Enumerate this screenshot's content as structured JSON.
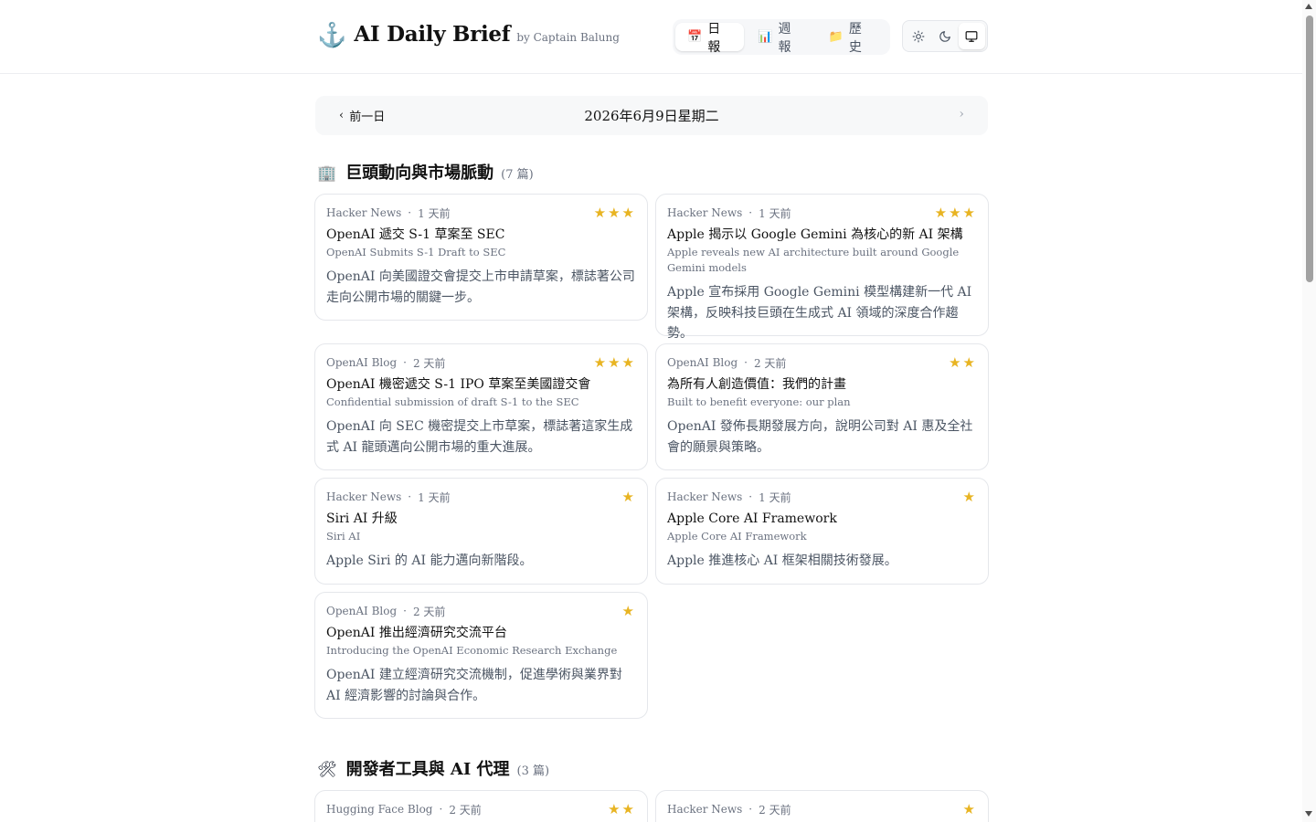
{
  "header": {
    "anchor_glyph": "⚓",
    "title": "AI Daily Brief",
    "byline": "by Captain Balung",
    "tabs": [
      {
        "label": "日報",
        "icon": "calendar-icon",
        "glyph": "📅"
      },
      {
        "label": "週報",
        "icon": "bar-chart-icon",
        "glyph": "📊"
      },
      {
        "label": "歷史",
        "icon": "folder-icon",
        "glyph": "📁"
      }
    ],
    "theme": {
      "active": "system"
    }
  },
  "datenav": {
    "prev_label": "前一日",
    "date": "2026年6月9日星期二"
  },
  "sections": [
    {
      "icon": "building-icon",
      "glyph": "🏢",
      "title": "巨頭動向與市場脈動",
      "count": "(7 篇)",
      "cards": [
        {
          "source": "Hacker News",
          "time": "1 天前",
          "stars": 3,
          "title": "OpenAI 遞交 S-1 草案至 SEC",
          "subtitle": "OpenAI Submits S-1 Draft to SEC",
          "desc": "OpenAI 向美國證交會提交上市申請草案，標誌著公司走向公開市場的關鍵一步。"
        },
        {
          "source": "Hacker News",
          "time": "1 天前",
          "stars": 3,
          "title": "Apple 揭示以 Google Gemini 為核心的新 AI 架構",
          "subtitle": "Apple reveals new AI architecture built around Google Gemini models",
          "desc": "Apple 宣布採用 Google Gemini 模型構建新一代 AI 架構，反映科技巨頭在生成式 AI 領域的深度合作趨勢。"
        },
        {
          "source": "OpenAI Blog",
          "time": "2 天前",
          "stars": 3,
          "title": "OpenAI 機密遞交 S-1 IPO 草案至美國證交會",
          "subtitle": "Confidential submission of draft S-1 to the SEC",
          "desc": "OpenAI 向 SEC 機密提交上市草案，標誌著這家生成式 AI 龍頭邁向公開市場的重大進展。"
        },
        {
          "source": "OpenAI Blog",
          "time": "2 天前",
          "stars": 2,
          "title": "為所有人創造價值：我們的計畫",
          "subtitle": "Built to benefit everyone: our plan",
          "desc": "OpenAI 發佈長期發展方向，說明公司對 AI 惠及全社會的願景與策略。"
        },
        {
          "source": "Hacker News",
          "time": "1 天前",
          "stars": 1,
          "title": "Siri AI 升級",
          "subtitle": "Siri AI",
          "desc": "Apple Siri 的 AI 能力邁向新階段。"
        },
        {
          "source": "Hacker News",
          "time": "1 天前",
          "stars": 1,
          "title": "Apple Core AI Framework",
          "subtitle": "Apple Core AI Framework",
          "desc": "Apple 推進核心 AI 框架相關技術發展。"
        },
        {
          "source": "OpenAI Blog",
          "time": "2 天前",
          "stars": 1,
          "title": "OpenAI 推出經濟研究交流平台",
          "subtitle": "Introducing the OpenAI Economic Research Exchange",
          "desc": "OpenAI 建立經濟研究交流機制，促進學術與業界對 AI 經濟影響的討論與合作。"
        }
      ]
    },
    {
      "icon": "hammer-wrench-icon",
      "glyph": "🛠",
      "title": "開發者工具與 AI 代理",
      "count": "(3 篇)",
      "cards": [
        {
          "source": "Hugging Face Blog",
          "time": "2 天前",
          "stars": 2
        },
        {
          "source": "Hacker News",
          "time": "2 天前",
          "stars": 1
        }
      ]
    }
  ]
}
